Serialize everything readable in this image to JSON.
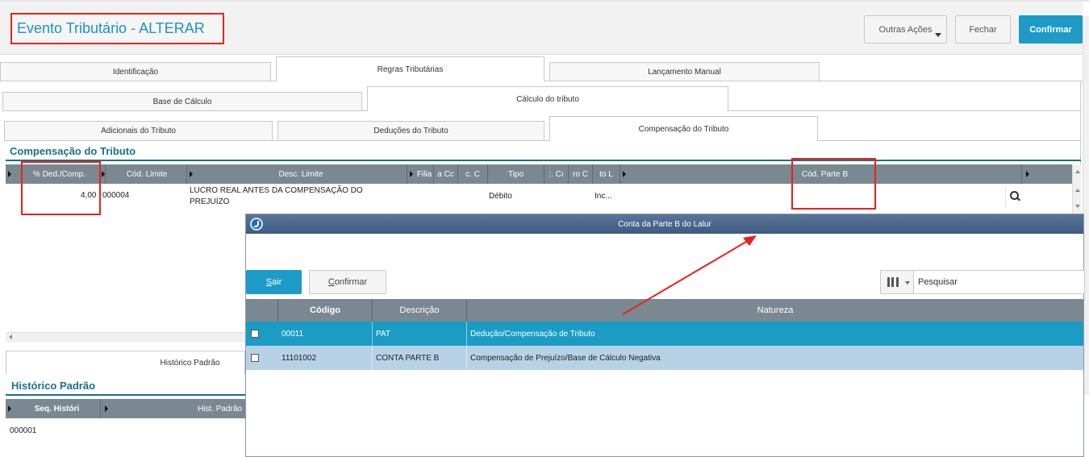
{
  "header": {
    "title": "Evento Tributário - ALTERAR",
    "more_actions": "Outras Ações",
    "close": "Fechar",
    "confirm": "Confirmar"
  },
  "tabs_level1": [
    {
      "label": "Identificação",
      "active": false
    },
    {
      "label": "Regras Tributárias",
      "active": true
    },
    {
      "label": "Lançamento Manual",
      "active": false
    }
  ],
  "tabs_level2": [
    {
      "label": "Base de Cálculo",
      "active": false
    },
    {
      "label": "Cálculo do tributo",
      "active": true
    }
  ],
  "tabs_level3": [
    {
      "label": "Adicionais do Tributo",
      "active": false
    },
    {
      "label": "Deduções do Tributo",
      "active": false
    },
    {
      "label": "Compensação do Tributo",
      "active": true
    }
  ],
  "compensacao": {
    "section_title": "Compensação do Tributo",
    "columns": [
      "% Ded./Comp.",
      "Cód. Limite",
      "Desc. Limite",
      "Filia",
      "a Cc",
      "c. C",
      "Tipo",
      ":. Cı",
      "ro C",
      "to L",
      "Cód. Parte B"
    ],
    "row": {
      "ded_comp": "4,00",
      "cod_limite": "000004",
      "desc_limite_line1": "LUCRO REAL ANTES DA COMPENSAÇÃO DO",
      "desc_limite_line2": "PREJUÍZO",
      "tipo": "Débito",
      "col_inc": "Inc..."
    }
  },
  "historico": {
    "tab_label": "Histórico Padrão",
    "section_title": "Histórico Padrão",
    "columns": [
      "Seq. Históri",
      "Hist. Padrão"
    ],
    "row_seq": "000001"
  },
  "dialog": {
    "title": "Conta da Parte B do Lalur",
    "exit_label_first": "S",
    "exit_label_rest": "air",
    "confirm_label_first": "C",
    "confirm_label_rest": "onfirmar",
    "search_placeholder": "Pesquisar",
    "columns": [
      "Código",
      "Descrição",
      "Natureza"
    ],
    "rows": [
      {
        "codigo": "00011",
        "descricao": "PAT",
        "natureza": "Dedução/Compensação de Tributo",
        "selected": true
      },
      {
        "codigo": "11101002",
        "descricao": "CONTA PARTE B",
        "natureza": "Compensação de Prejuízo/Base de Cálculo Negativa",
        "selected": false
      }
    ]
  },
  "colors": {
    "accent": "#1d9bc6",
    "annotation_red": "#e8221b",
    "grid_header": "#7a8891",
    "section_title": "#1a6f8e"
  }
}
